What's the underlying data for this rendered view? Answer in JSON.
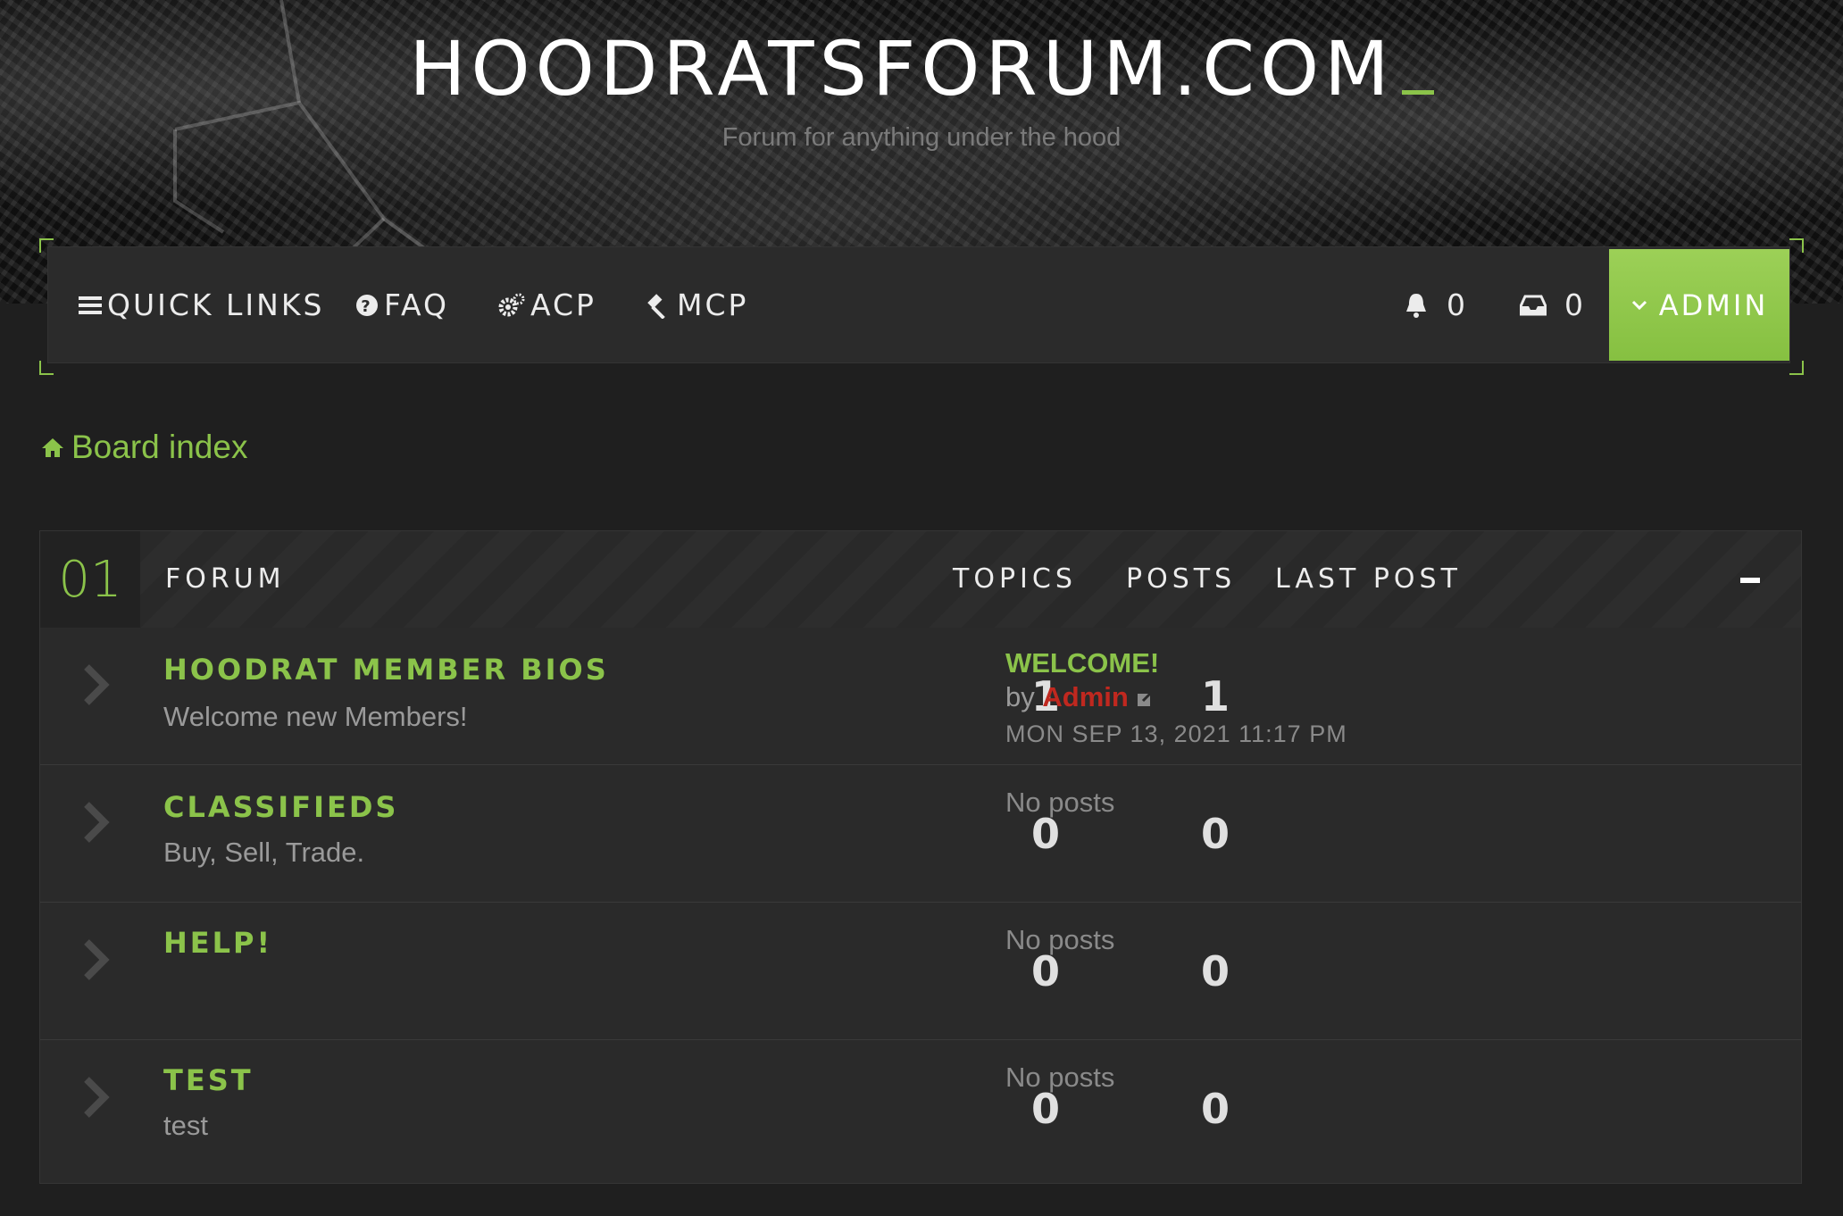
{
  "site": {
    "title": "HOODRATSFORUM.COM",
    "description": "Forum for anything under the hood"
  },
  "navbar": {
    "quick_links": "QUICK LINKS",
    "faq": "FAQ",
    "acp": "ACP",
    "mcp": "MCP",
    "notifications_count": "0",
    "messages_count": "0",
    "user": "ADMIN"
  },
  "breadcrumb": {
    "board_index": "Board index"
  },
  "category": {
    "number": "01",
    "columns": {
      "forum": "FORUM",
      "topics": "TOPICS",
      "posts": "POSTS",
      "last_post": "LAST POST"
    },
    "forums": [
      {
        "title": "HOODRAT MEMBER BIOS",
        "description": "Welcome new Members!",
        "topics": "1",
        "posts": "1",
        "last_post": {
          "title": "WELCOME!",
          "by": "by",
          "author": "Admin",
          "date": "MON SEP 13, 2021 11:17 PM"
        }
      },
      {
        "title": "CLASSIFIEDS",
        "description": "Buy, Sell, Trade.",
        "topics": "0",
        "posts": "0",
        "last_post_none": "No posts"
      },
      {
        "title": "HELP!",
        "description": "",
        "topics": "0",
        "posts": "0",
        "last_post_none": "No posts"
      },
      {
        "title": "TEST",
        "description": "test",
        "topics": "0",
        "posts": "0",
        "last_post_none": "No posts"
      }
    ]
  },
  "colors": {
    "accent": "#8bc34a",
    "author": "#c0281f",
    "background": "#1f1f1f",
    "panel": "#2a2a2a"
  }
}
